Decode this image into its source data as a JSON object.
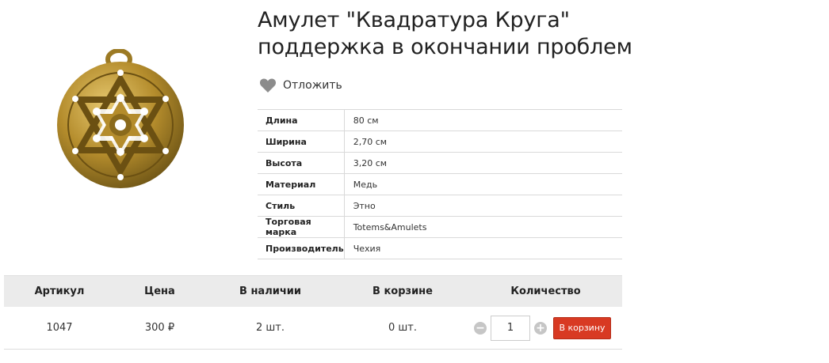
{
  "product": {
    "title_line1": "Амулет \"Квадратура Круга\"",
    "title_line2": "поддержка в окончании проблем",
    "image_alt": "Амулет Квадратура Круга",
    "wishlist_label": "Отложить"
  },
  "specs": [
    {
      "key": "Длина",
      "value": "80 см"
    },
    {
      "key": "Ширина",
      "value": "2,70 см"
    },
    {
      "key": "Высота",
      "value": "3,20 см"
    },
    {
      "key": "Материал",
      "value": "Медь"
    },
    {
      "key": "Стиль",
      "value": "Этно"
    },
    {
      "key": "Торговая марка",
      "value": "Totems&Amulets"
    },
    {
      "key": "Производитель",
      "value": "Чехия"
    }
  ],
  "order": {
    "headers": [
      "Артикул",
      "Цена",
      "В наличии",
      "В корзине",
      "Количество"
    ],
    "article": "1047",
    "price": "300 ₽",
    "in_stock": "2 шт.",
    "in_cart": "0 шт.",
    "quantity": "1",
    "minus_label": "−",
    "plus_label": "+",
    "add_to_cart_label": "В корзину"
  },
  "colors": {
    "accent": "#d83a23",
    "heart": "#8c8c8c",
    "amulet": "#b8912f"
  }
}
